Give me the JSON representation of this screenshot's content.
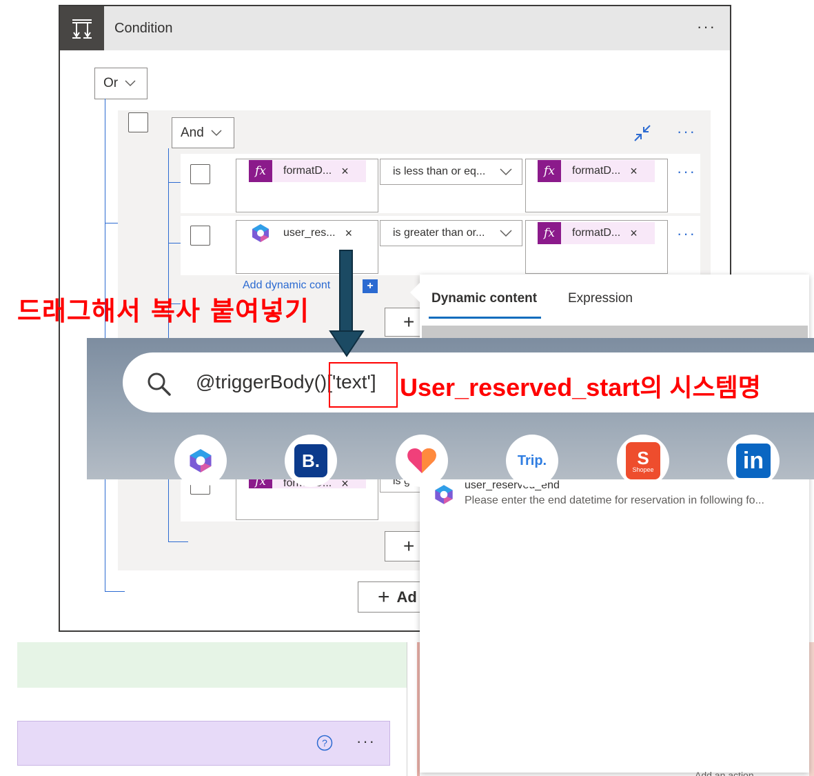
{
  "condition": {
    "title": "Condition",
    "menu": "···",
    "or_label": "Or",
    "and_label": "And",
    "group_menu": "···",
    "rows": [
      {
        "left_token": "formatD...",
        "left_type": "fx",
        "operator": "is less than or eq...",
        "right_token": "formatD...",
        "right_type": "fx",
        "menu": "···"
      },
      {
        "left_token": "user_res...",
        "left_type": "copilot",
        "operator": "is greater than or...",
        "right_token": "formatD...",
        "right_type": "fx",
        "menu": "···"
      },
      {
        "left_token": "formatD...",
        "left_type": "fx",
        "operator": "is gre",
        "menu": ""
      }
    ],
    "token_remove": "×",
    "add_dynamic_content": "Add dynamic cont",
    "add_dynamic_content_tail": "t",
    "add_plus": "+",
    "add_label": "Ad"
  },
  "dynamic_panel": {
    "tabs": [
      {
        "label": "Dynamic content",
        "active": true
      },
      {
        "label": "Expression",
        "active": false
      }
    ],
    "items": [
      {
        "name": "user_reserved_end",
        "description": "Please enter the end datetime for reservation in following fo..."
      }
    ],
    "footer_partial": "Add an action"
  },
  "search_overlay": {
    "query_prefix": "@triggerBody()",
    "query_highlight": "['text']",
    "annotation": "User_reserved_start의 시스템명",
    "apps": [
      {
        "name": "copilot-app-icon"
      },
      {
        "name": "booking-app-icon",
        "label": "B."
      },
      {
        "name": "heart-app-icon"
      },
      {
        "name": "trip-app-icon",
        "label": "Trip."
      },
      {
        "name": "shopee-app-icon",
        "label": "Shopee"
      },
      {
        "name": "linkedin-app-icon",
        "label": "in"
      }
    ]
  },
  "instruction": "드래그해서 복사 붙여넣기",
  "branch": {
    "help": "?",
    "menu": "···"
  },
  "colors": {
    "accent": "#2b6ad1",
    "annotation_red": "#ff0000",
    "fx_purple": "#8b1a8b",
    "arrow": "#1b4a63"
  }
}
